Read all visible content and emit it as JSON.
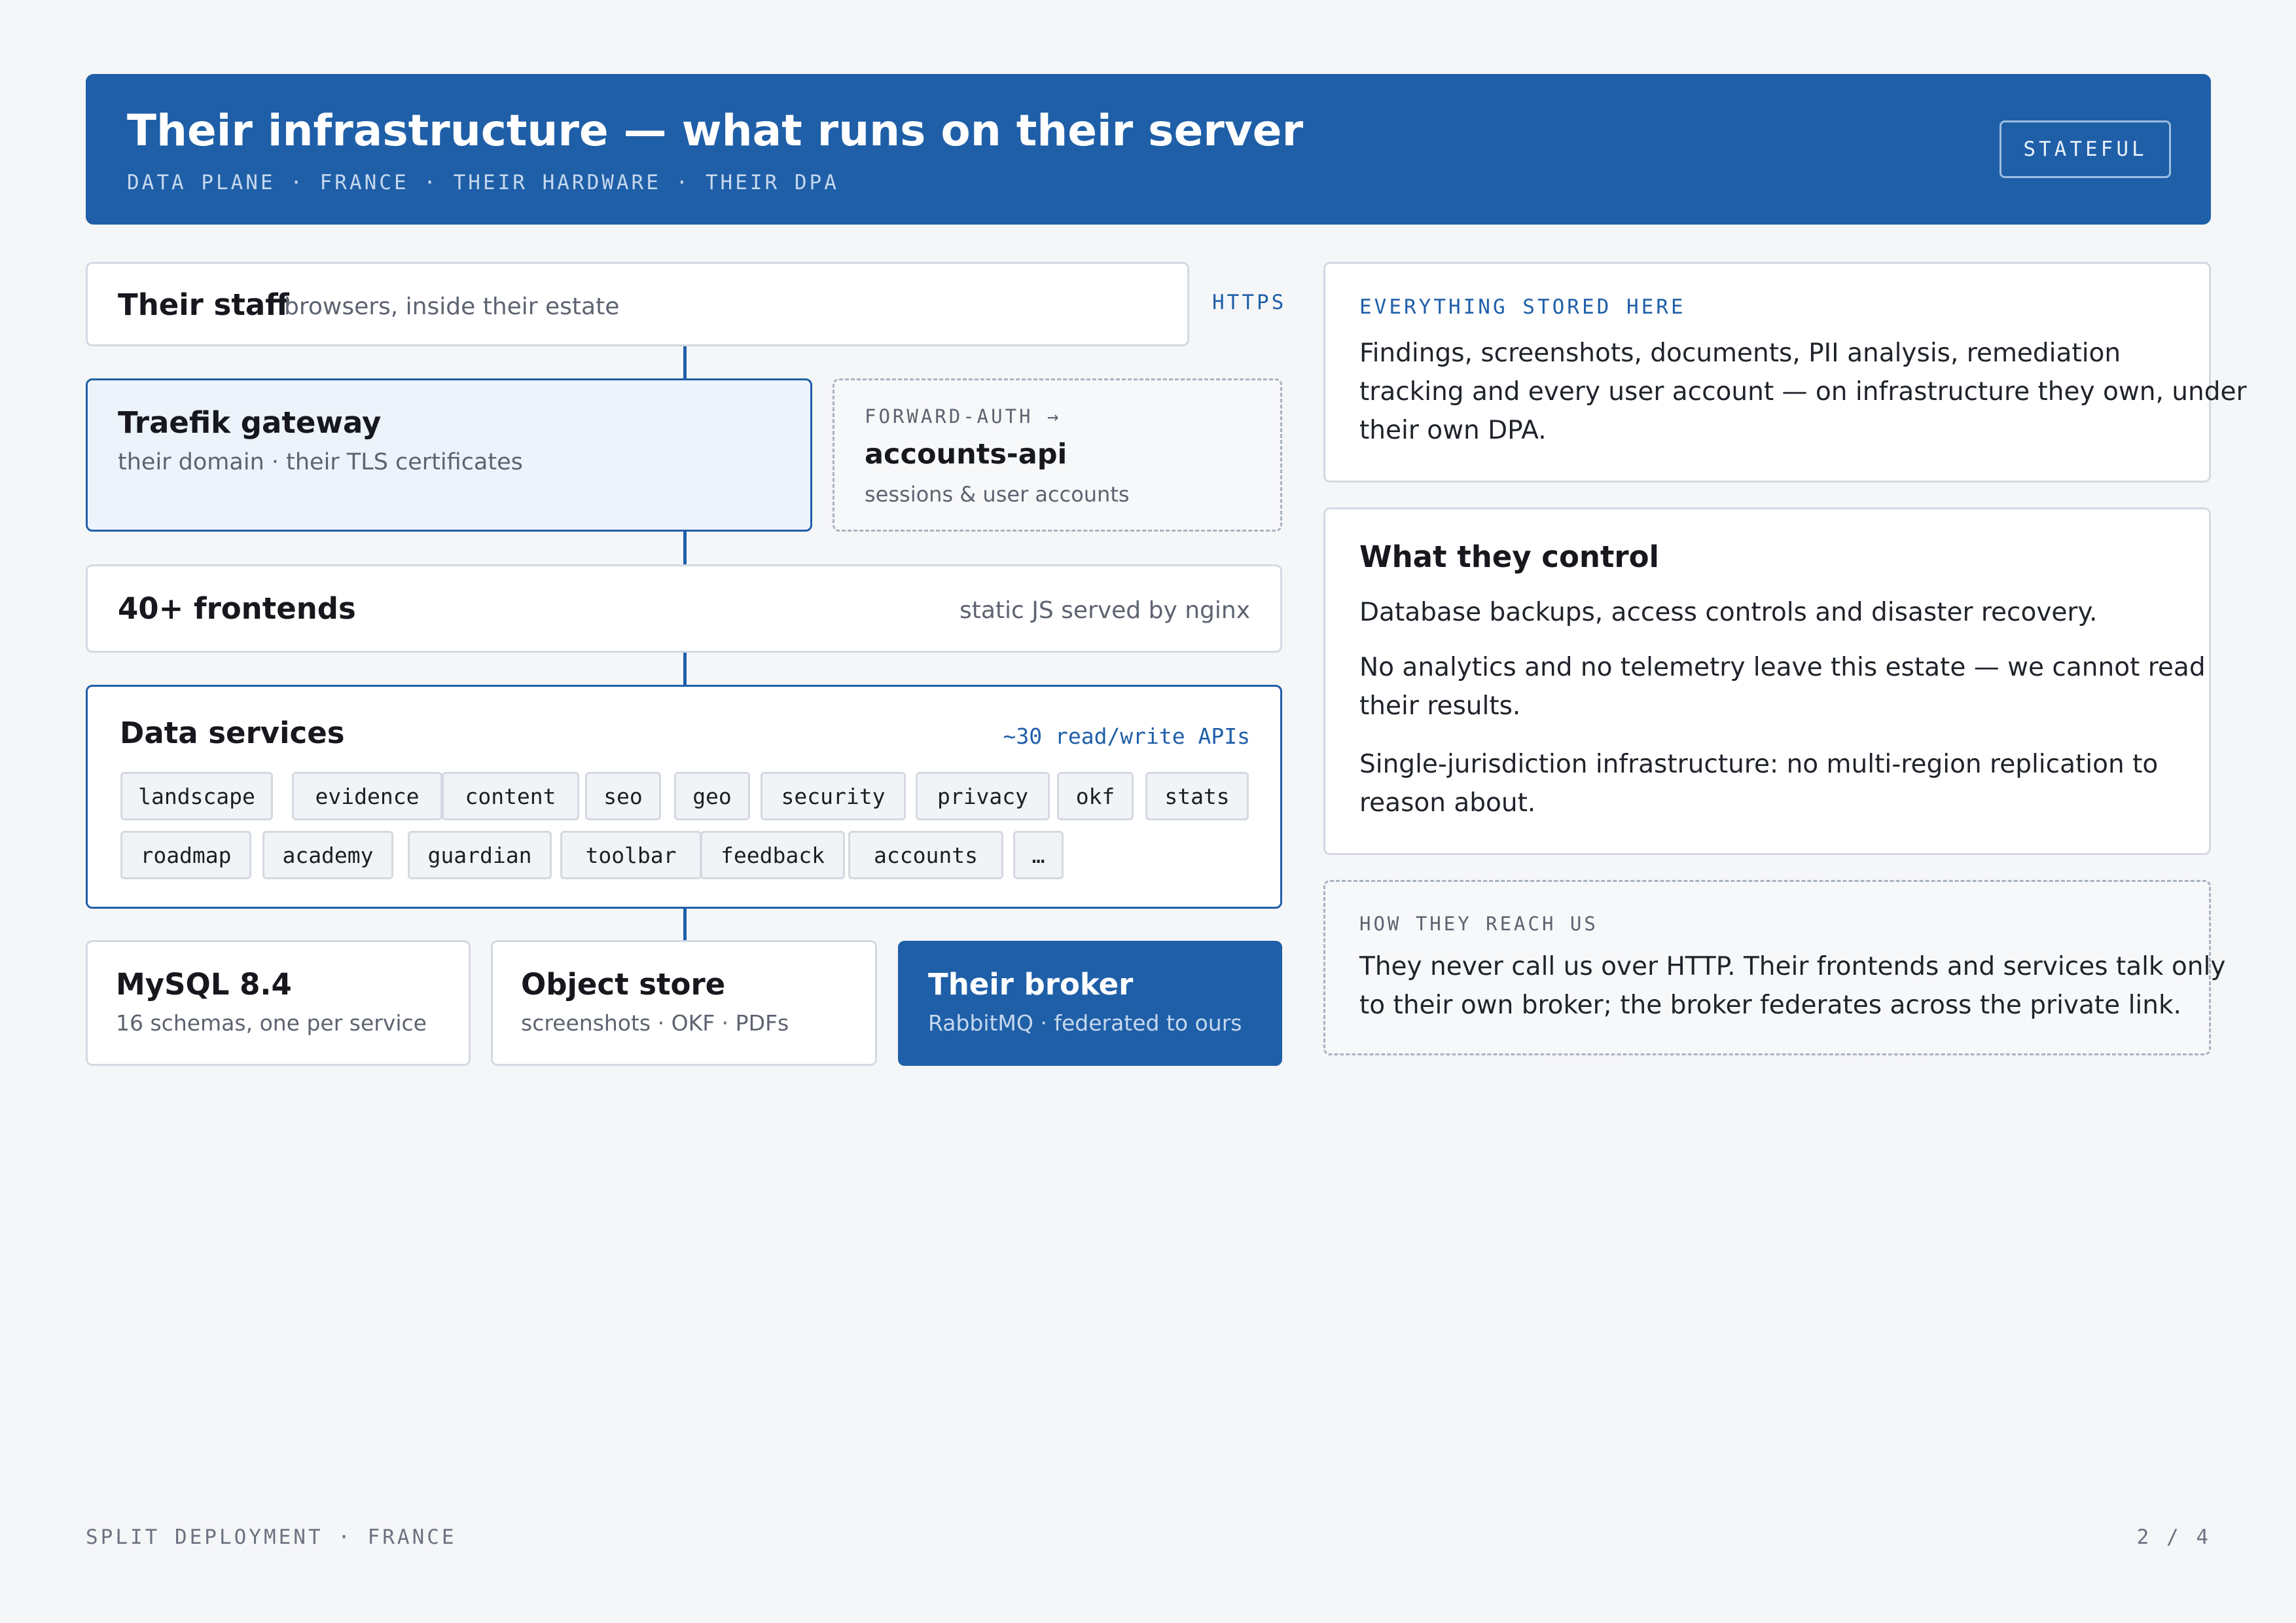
{
  "header": {
    "title": "Their infrastructure — what runs on their server",
    "subtitle": "DATA PLANE · FRANCE · THEIR HARDWARE · THEIR DPA",
    "badge": "STATEFUL"
  },
  "staff": {
    "title": "Their staff",
    "subtitle": "browsers, inside their estate",
    "protocol": "HTTPS"
  },
  "gateway": {
    "title": "Traefik gateway",
    "subtitle": "their domain · their TLS certificates"
  },
  "auth": {
    "kicker": "FORWARD-AUTH →",
    "title": "accounts-api",
    "subtitle": "sessions & user accounts"
  },
  "frontends": {
    "title": "40+ frontends",
    "subtitle": "static JS served by nginx"
  },
  "data_services": {
    "title": "Data services",
    "note": "~30 read/write APIs",
    "chips": [
      "landscape",
      "evidence",
      "content",
      "seo",
      "geo",
      "security",
      "privacy",
      "okf",
      "stats",
      "roadmap",
      "academy",
      "guardian",
      "toolbar",
      "feedback",
      "accounts",
      "…"
    ]
  },
  "mysql": {
    "title": "MySQL 8.4",
    "subtitle": "16 schemas, one per service"
  },
  "object_store": {
    "title": "Object store",
    "subtitle": "screenshots · OKF · PDFs"
  },
  "broker": {
    "title": "Their broker",
    "subtitle": "RabbitMQ · federated to ours"
  },
  "stored": {
    "kicker": "EVERYTHING STORED HERE",
    "lines": [
      "Findings, screenshots, documents, PII analysis, remediation",
      "tracking and every user account — on infrastructure they own, under",
      "their own DPA."
    ]
  },
  "control": {
    "title": "What they control",
    "p1": "Database backups, access controls and disaster recovery.",
    "p2_lines": [
      "No analytics and no telemetry leave this estate — we cannot read",
      "their results."
    ],
    "p3_lines": [
      "Single-jurisdiction infrastructure: no multi-region replication to",
      "reason about."
    ]
  },
  "reach": {
    "kicker": "HOW THEY REACH US",
    "lines": [
      "They never call us over HTTP. Their frontends and services talk only",
      "to their own broker; the broker federates across the private link."
    ]
  },
  "footer": {
    "left": "SPLIT DEPLOYMENT · FRANCE",
    "right": "2 / 4"
  },
  "colors": {
    "brand_blue": "#1f5fa8",
    "light_blue_fill": "#edf3fb",
    "page_bg": "#f5f6f8"
  }
}
